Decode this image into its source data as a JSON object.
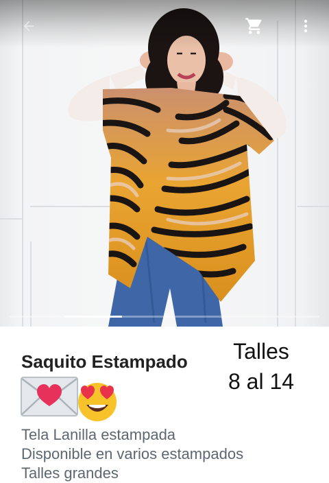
{
  "product": {
    "title": "Saquito Estampado",
    "sizes_label": "Talles",
    "sizes_range": "8 al 14",
    "description_lines": [
      "Tela Lanilla estampada",
      "Disponible en varios estampados",
      "Talles grandes"
    ]
  },
  "icons": {
    "back": "back-arrow-icon",
    "cart": "cart-icon",
    "more": "more-vert-icon",
    "emoji_1": "love-letter-emoji",
    "emoji_2": "heart-eyes-emoji"
  },
  "colors": {
    "title": "#222222",
    "description": "#5d6771",
    "pattern_orange": "#e8a21c",
    "pattern_black": "#1a1412",
    "jeans": "#3f67a8"
  }
}
